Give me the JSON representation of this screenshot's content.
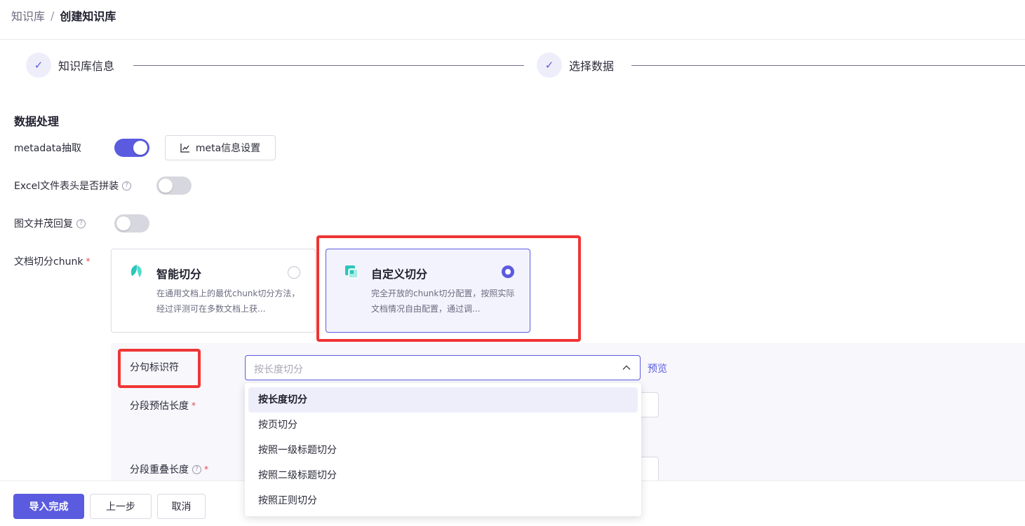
{
  "breadcrumb": {
    "parent": "知识库",
    "separator": "/",
    "current": "创建知识库"
  },
  "steps": [
    {
      "label": "知识库信息",
      "check": "✓"
    },
    {
      "label": "选择数据",
      "check": "✓"
    }
  ],
  "section_title": "数据处理",
  "metadata": {
    "label": "metadata抽取",
    "enabled": true,
    "button_label": "meta信息设置",
    "button_icon": "line-chart-icon"
  },
  "excel_header": {
    "label": "Excel文件表头是否拼装",
    "help": "?",
    "enabled": false
  },
  "image_text": {
    "label": "图文并茂回复",
    "help": "?",
    "enabled": false
  },
  "chunk": {
    "label": "文档切分chunk",
    "required_mark": "*",
    "options": [
      {
        "title": "智能切分",
        "desc": "在通用文档上的最优chunk切分方法，经过评测可在多数文档上获...",
        "selected": false,
        "icon": "leaf-icon"
      },
      {
        "title": "自定义切分",
        "desc": "完全开放的chunk切分配置，按照实际文档情况自由配置，通过调...",
        "selected": true,
        "icon": "custom-split-icon"
      }
    ]
  },
  "custom": {
    "separator_label": "分句标识符",
    "select_placeholder": "按长度切分",
    "preview_label": "预览",
    "chunk_length_label": "分段预估长度",
    "overlap_label": "分段重叠长度",
    "required_mark": "*",
    "help": "?"
  },
  "dropdown": {
    "items": [
      {
        "label": "按长度切分",
        "active": true
      },
      {
        "label": "按页切分",
        "active": false
      },
      {
        "label": "按照一级标题切分",
        "active": false
      },
      {
        "label": "按照二级标题切分",
        "active": false
      },
      {
        "label": "按照正则切分",
        "active": false
      }
    ]
  },
  "footer": {
    "finish": "导入完成",
    "prev": "上一步",
    "cancel": "取消"
  },
  "colors": {
    "accent": "#5b5be0",
    "highlight": "#ef3535",
    "required": "#e5484d"
  }
}
